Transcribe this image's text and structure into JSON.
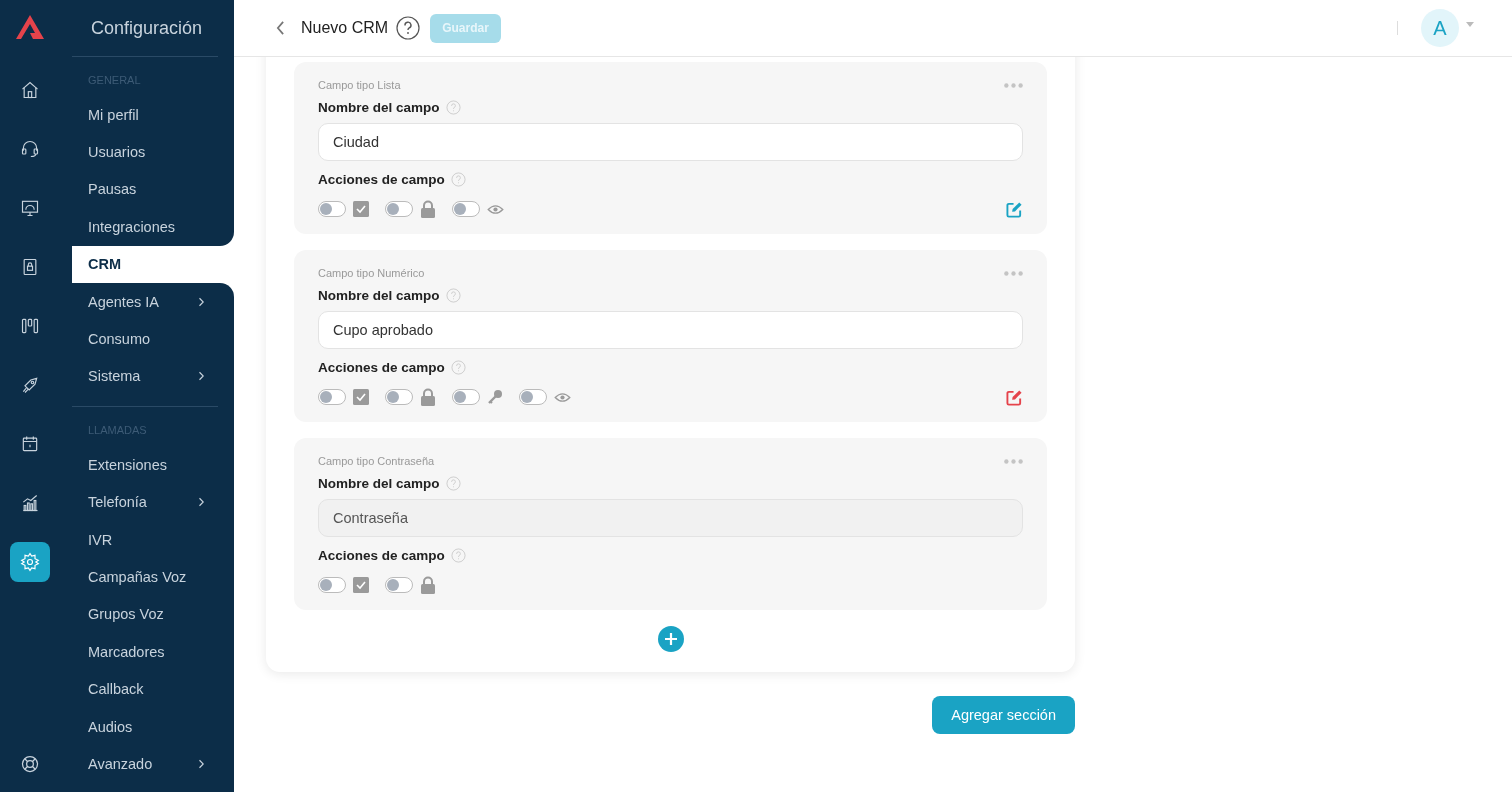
{
  "rail": [
    {
      "kind": "home",
      "selected": false
    },
    {
      "kind": "headset",
      "selected": false
    },
    {
      "kind": "monitor",
      "selected": false
    },
    {
      "kind": "book",
      "selected": false
    },
    {
      "kind": "board",
      "selected": false
    },
    {
      "kind": "rocket",
      "selected": false
    },
    {
      "kind": "calendar",
      "selected": false
    },
    {
      "kind": "chart",
      "selected": false
    },
    {
      "kind": "gear",
      "selected": true
    }
  ],
  "sidebar": {
    "title": "Configuración",
    "sections": [
      {
        "label": "GENERAL",
        "items": [
          {
            "label": "Mi perfil",
            "selected": false,
            "expandable": false
          },
          {
            "label": "Usuarios",
            "selected": false,
            "expandable": false
          },
          {
            "label": "Pausas",
            "selected": false,
            "expandable": false
          },
          {
            "label": "Integraciones",
            "selected": false,
            "expandable": false
          },
          {
            "label": "CRM",
            "selected": true,
            "expandable": false
          },
          {
            "label": "Agentes IA",
            "selected": false,
            "expandable": true
          },
          {
            "label": "Consumo",
            "selected": false,
            "expandable": false
          },
          {
            "label": "Sistema",
            "selected": false,
            "expandable": true
          }
        ]
      },
      {
        "label": "LLAMADAS",
        "items": [
          {
            "label": "Extensiones",
            "selected": false,
            "expandable": false
          },
          {
            "label": "Telefonía",
            "selected": false,
            "expandable": true
          },
          {
            "label": "IVR",
            "selected": false,
            "expandable": false
          },
          {
            "label": "Campañas Voz",
            "selected": false,
            "expandable": false
          },
          {
            "label": "Grupos Voz",
            "selected": false,
            "expandable": false
          },
          {
            "label": "Marcadores",
            "selected": false,
            "expandable": false
          },
          {
            "label": "Callback",
            "selected": false,
            "expandable": false
          },
          {
            "label": "Audios",
            "selected": false,
            "expandable": false
          },
          {
            "label": "Avanzado",
            "selected": false,
            "expandable": true
          }
        ]
      }
    ]
  },
  "header": {
    "title": "Nuevo CRM",
    "save_button": {
      "label": "Guardar",
      "disabled": true
    },
    "avatar": "A"
  },
  "fields": [
    {
      "type_label": "Campo tipo Lista",
      "name_label": "Nombre del campo",
      "value": "Ciudad",
      "disabled": false,
      "actions_label": "Acciones de campo",
      "actions": [
        {
          "kind": "check",
          "on": false
        },
        {
          "kind": "lock",
          "on": false
        },
        {
          "kind": "eye",
          "on": false
        }
      ],
      "edit": {
        "color": "#1aa3c4"
      }
    },
    {
      "type_label": "Campo tipo Numérico",
      "name_label": "Nombre del campo",
      "value": "Cupo aprobado",
      "disabled": false,
      "actions_label": "Acciones de campo",
      "actions": [
        {
          "kind": "check",
          "on": false
        },
        {
          "kind": "lock",
          "on": false
        },
        {
          "kind": "key",
          "on": false
        },
        {
          "kind": "eye",
          "on": false
        }
      ],
      "edit": {
        "color": "#e5434b"
      }
    },
    {
      "type_label": "Campo tipo Contraseña",
      "name_label": "Nombre del campo",
      "value": "Contraseña",
      "disabled": true,
      "actions_label": "Acciones de campo",
      "actions": [
        {
          "kind": "check",
          "on": false
        },
        {
          "kind": "lock",
          "on": false
        }
      ]
    }
  ],
  "add_section_button": "Agregar sección"
}
